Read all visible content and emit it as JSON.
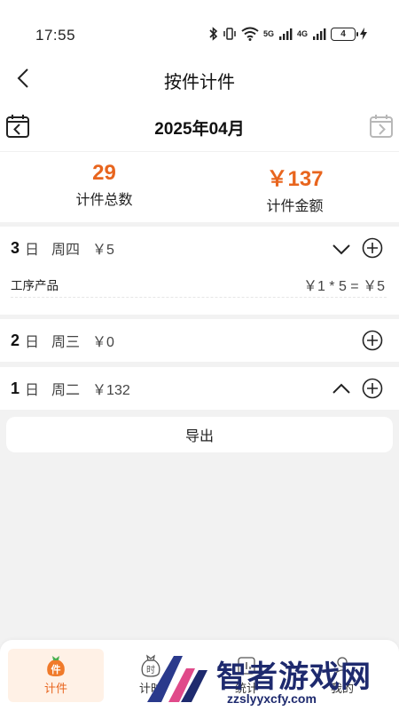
{
  "status_bar": {
    "time": "17:55",
    "network_5g": "5G",
    "network_4g": "4G",
    "battery": "4"
  },
  "nav": {
    "title": "按件计件"
  },
  "month": {
    "label": "2025年04月"
  },
  "summary": {
    "count_value": "29",
    "count_label": "计件总数",
    "amount_value": "￥137",
    "amount_label": "计件金额",
    "accent_color": "#e8651e"
  },
  "days": [
    {
      "num": "3",
      "unit": "日",
      "weekday": "周四",
      "amount": "￥5",
      "expanded": true,
      "items": [
        {
          "name": "工序产品",
          "calc": "￥1 * 5 =  ￥5"
        }
      ]
    },
    {
      "num": "2",
      "unit": "日",
      "weekday": "周三",
      "amount": "￥0",
      "expanded": false,
      "items": []
    },
    {
      "num": "1",
      "unit": "日",
      "weekday": "周二",
      "amount": "￥132",
      "expanded": false,
      "items": []
    }
  ],
  "export_label": "导出",
  "tabs": [
    {
      "label": "计件",
      "icon": "piece-bag-icon",
      "active": true
    },
    {
      "label": "计时",
      "icon": "time-bag-icon",
      "active": false
    },
    {
      "label": "统计",
      "icon": "stats-icon",
      "active": false
    },
    {
      "label": "我的",
      "icon": "profile-icon",
      "active": false
    }
  ],
  "watermark": {
    "text": "智者游戏网",
    "url": "zzslyyxcfy.com"
  }
}
